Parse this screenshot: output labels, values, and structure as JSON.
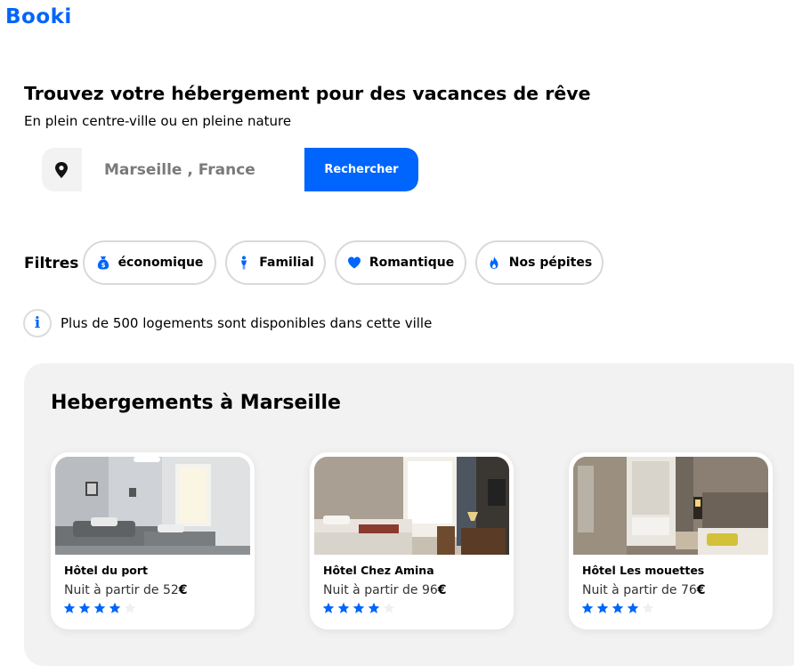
{
  "header": {
    "logo": "Booki"
  },
  "hero": {
    "title": "Trouvez votre hébergement pour des vacances de rêve",
    "subtitle": "En plein centre-ville ou en pleine nature"
  },
  "search": {
    "value": "Marseille , France",
    "placeholder": "Marseille , France",
    "button_label": "Rechercher",
    "icon": "map-pin-icon"
  },
  "filters": {
    "label": "Filtres",
    "items": [
      {
        "label": "économique",
        "icon": "money-bag-icon"
      },
      {
        "label": "Familial",
        "icon": "person-icon"
      },
      {
        "label": "Romantique",
        "icon": "heart-icon"
      },
      {
        "label": "Nos pépites",
        "icon": "fire-icon"
      }
    ]
  },
  "info": {
    "text": "Plus de 500 logements sont disponibles dans cette ville",
    "icon": "info-icon"
  },
  "listings": {
    "title": "Hebergements à Marseille",
    "cards": [
      {
        "name": "Hôtel du port",
        "price_prefix": "Nuit à partir de 52",
        "currency": "€",
        "rating": 4,
        "max_rating": 5
      },
      {
        "name": "Hôtel Chez Amina",
        "price_prefix": "Nuit à partir de 96",
        "currency": "€",
        "rating": 4,
        "max_rating": 5
      },
      {
        "name": "Hôtel Les mouettes",
        "price_prefix": "Nuit à partir de 76",
        "currency": "€",
        "rating": 4,
        "max_rating": 5
      }
    ]
  },
  "colors": {
    "accent": "#0065fc",
    "panel_bg": "#f2f2f2",
    "star_empty": "#f0f0f0"
  }
}
